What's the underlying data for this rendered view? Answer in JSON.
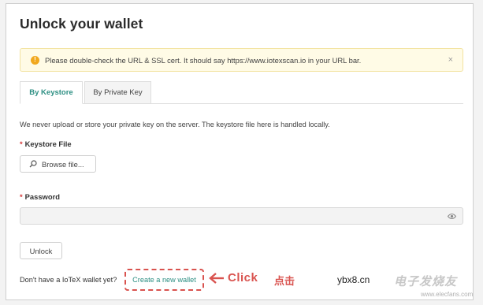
{
  "page": {
    "title": "Unlock your wallet"
  },
  "alert": {
    "icon": "info-icon",
    "text": "Please double-check the URL & SSL cert. It should say https://www.iotexscan.io in your URL bar.",
    "close": "×"
  },
  "tabs": [
    {
      "label": "By Keystore",
      "active": true
    },
    {
      "label": "By Private Key",
      "active": false
    }
  ],
  "form": {
    "info": "We never upload or store your private key on the server. The keystore file here is handled locally.",
    "required_mark": "*",
    "keystore_label": "Keystore File",
    "browse_label": "Browse file...",
    "password_label": "Password",
    "password_value": "",
    "unlock_label": "Unlock"
  },
  "footer": {
    "no_wallet_text": "Don't have a IoTeX wallet yet?",
    "create_link": "Create a new wallet",
    "annotation_click": "Click",
    "annotation_cn": "点击"
  },
  "watermark": {
    "logo": "ybx8.cn",
    "main": "电子发烧友",
    "url": "www.elecfans.com"
  },
  "colors": {
    "accent": "#2d8f83",
    "warning": "#f1a81e",
    "required": "#d63b3b",
    "annotation": "#d9534f"
  }
}
